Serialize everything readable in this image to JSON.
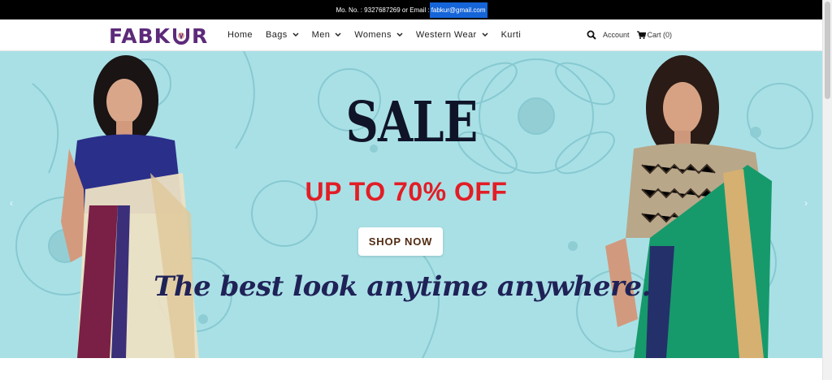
{
  "topbar": {
    "prefix": "Mo. No. : 9327687269 or Email : ",
    "email": "fabkur@gmail.com"
  },
  "brand": {
    "logo_left": "FABK",
    "logo_right": "R",
    "color": "#5d2a7a"
  },
  "menu": {
    "items": [
      {
        "label": "Home",
        "dropdown": false
      },
      {
        "label": "Bags",
        "dropdown": true
      },
      {
        "label": "Men",
        "dropdown": true
      },
      {
        "label": "Womens",
        "dropdown": true
      },
      {
        "label": "Western Wear",
        "dropdown": true
      },
      {
        "label": "Kurti",
        "dropdown": false
      }
    ],
    "chevron": "⌄"
  },
  "header_right": {
    "search_icon": "search-icon",
    "account_label": "Account",
    "cart_label": "Cart (0)",
    "cart_icon": "cart-icon"
  },
  "hero": {
    "headline": "SALE",
    "offer": "UP TO 70% OFF",
    "cta": "SHOP NOW",
    "tagline": "The best look anytime anywhere.",
    "bg_color": "#a9e0e6",
    "offer_color": "#e21d25",
    "prev_icon": "chevron-left-icon",
    "next_icon": "chevron-right-icon"
  }
}
